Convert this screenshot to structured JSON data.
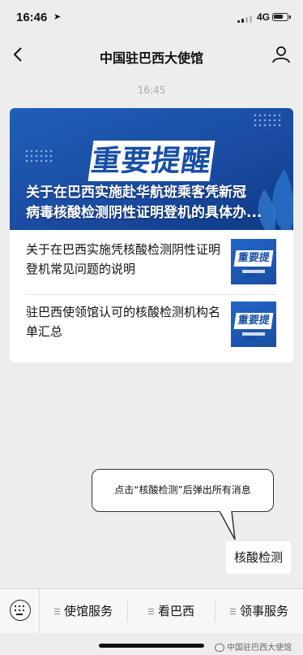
{
  "status_bar": {
    "time": "16:46",
    "network": "4G",
    "battery_level": 0.75,
    "signal_bars": 2
  },
  "nav": {
    "title": "中国驻巴西大使馆"
  },
  "chat": {
    "timestamp": "16:45"
  },
  "article_card": {
    "banner_logo": "重要提醒",
    "banner_title_line1": "关于在巴西实施赴华航班乘客凭新冠",
    "banner_title_line2": "病毒核酸检测阴性证明登机的具体办...",
    "items": [
      {
        "title": "关于在巴西实施凭核酸检测阴性证明登机常见问题的说明",
        "thumb_text": "重要提醒"
      },
      {
        "title": "驻巴西使领馆认可的核酸检测机构名单汇总",
        "thumb_text": "重要提醒"
      }
    ]
  },
  "annotation": {
    "text": "点击“核酸检测”后弹出所有消息"
  },
  "floating_button": {
    "label": "核酸检测"
  },
  "menu": {
    "items": [
      "使馆服务",
      "看巴西",
      "领事服务"
    ]
  },
  "watermark": {
    "text": "中国驻巴西大使馆"
  }
}
